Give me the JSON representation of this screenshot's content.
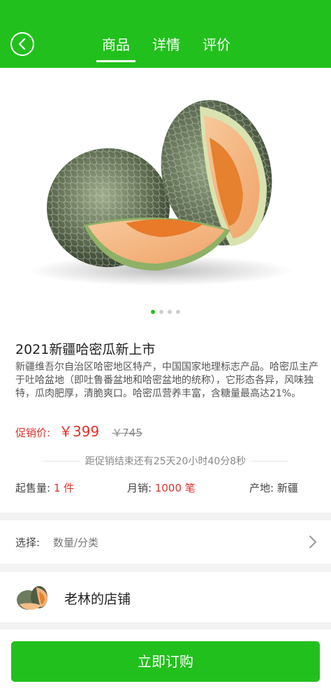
{
  "header": {
    "tabs": [
      {
        "label": "商品",
        "active": true
      },
      {
        "label": "详情",
        "active": false
      },
      {
        "label": "评价",
        "active": false
      }
    ],
    "accent_color": "#22c01d"
  },
  "hero": {
    "carousel_total": 4,
    "carousel_active": 1
  },
  "product": {
    "title": "2021新疆哈密瓜新上市",
    "description": "新疆维吾尔自治区哈密地区特产，中国国家地理标志产品。哈密瓜主产于吐哈盆地（即吐鲁番盆地和哈密盆地的统称），它形态各异，风味独特，瓜肉肥厚，清脆爽口。哈密瓜营养丰富，含糖量最高达21%。",
    "price_label": "促销价:",
    "price": "￥399",
    "original_price": "￥745",
    "countdown": "距促销结束还有25天20小时40分8秒",
    "min_order_label": "起售量:",
    "min_order_value": "1 件",
    "monthly_sales_label": "月销:",
    "monthly_sales_value": "1000 笔",
    "origin_label": "产地:",
    "origin_value": "新疆",
    "price_color": "#e0322b"
  },
  "select": {
    "label": "选择:",
    "value": "数量/分类"
  },
  "shop": {
    "name": "老林的店铺"
  },
  "bottom": {
    "buy_label": "立即订购"
  }
}
